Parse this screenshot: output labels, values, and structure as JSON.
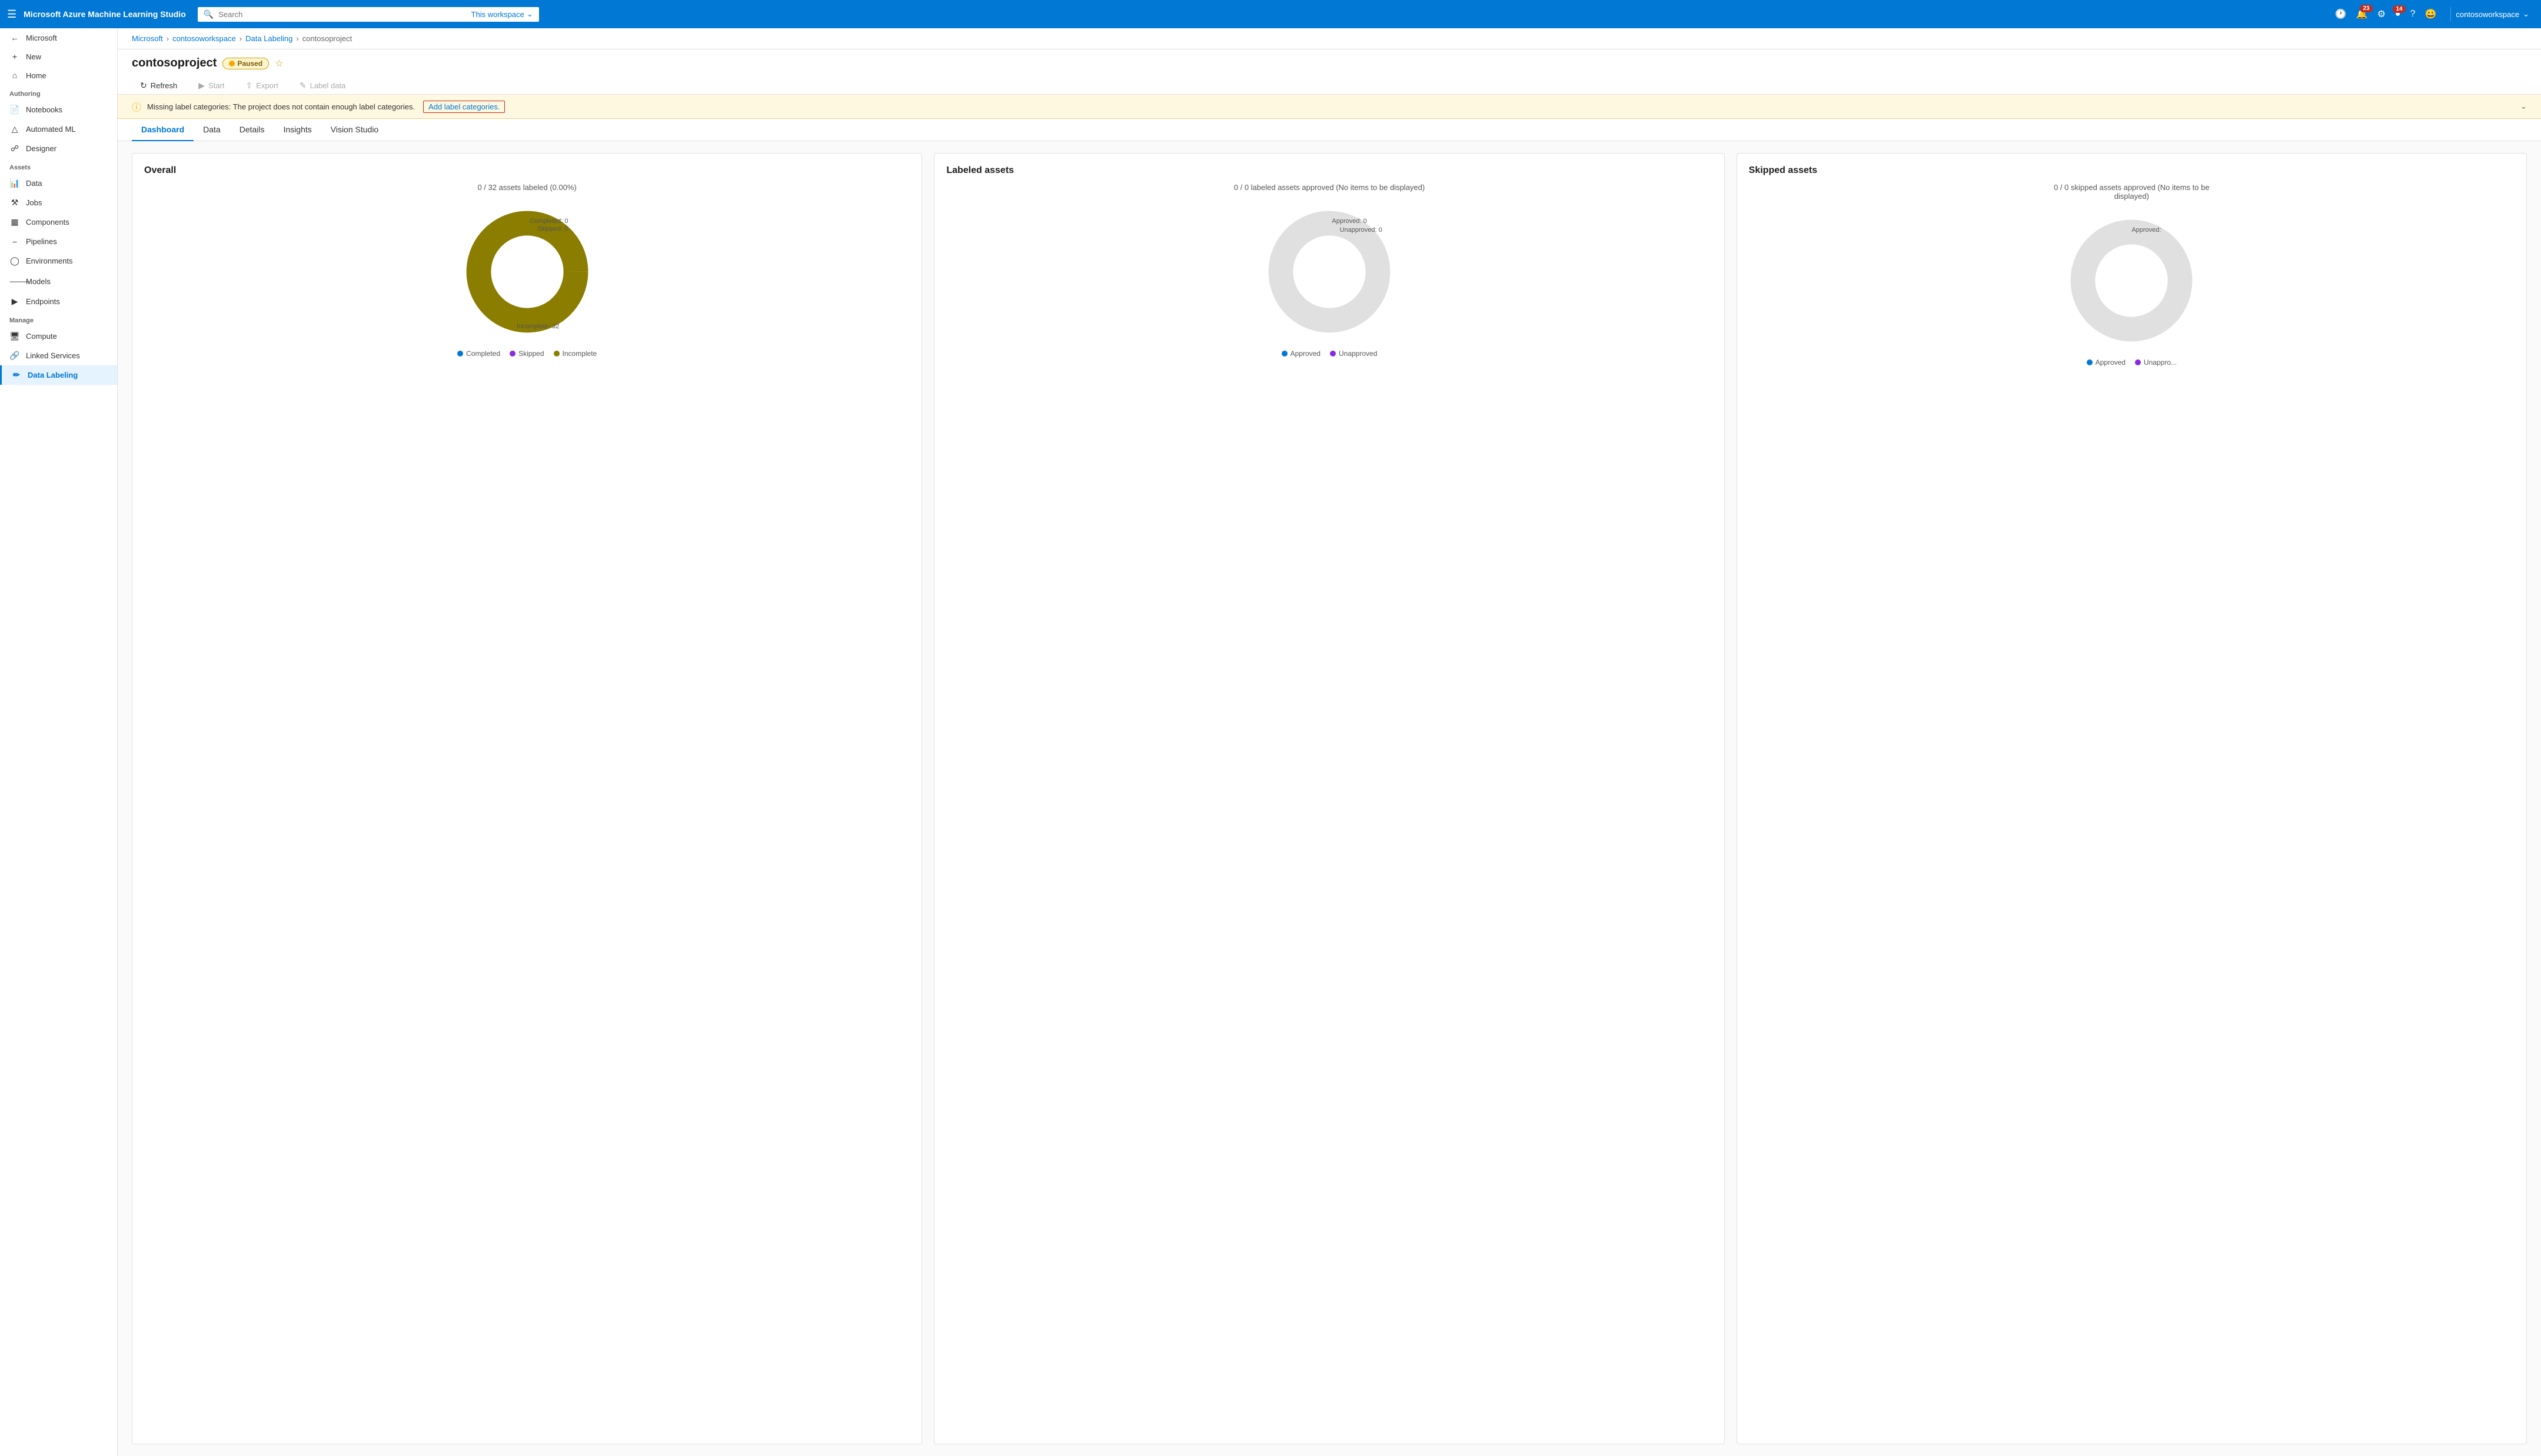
{
  "app": {
    "title": "Microsoft Azure Machine Learning Studio"
  },
  "topbar": {
    "search_placeholder": "Search",
    "search_scope": "This workspace",
    "notifications_count": "23",
    "settings_updates": "14",
    "workspace_name": "contosoworkspace"
  },
  "breadcrumb": {
    "items": [
      "Microsoft",
      "contosoworkspace",
      "Data Labeling",
      "contosoproject"
    ]
  },
  "project": {
    "name": "contosoproject",
    "status": "Paused"
  },
  "toolbar": {
    "refresh": "Refresh",
    "start": "Start",
    "export": "Export",
    "label_data": "Label data"
  },
  "warning": {
    "message": "Missing label categories: The project does not contain enough label categories.",
    "link_text": "Add label categories."
  },
  "tabs": {
    "items": [
      "Dashboard",
      "Data",
      "Details",
      "Insights",
      "Vision Studio"
    ],
    "active": "Dashboard"
  },
  "sidebar": {
    "microsoft_label": "Microsoft",
    "new_label": "New",
    "home_label": "Home",
    "authoring_label": "Authoring",
    "notebooks_label": "Notebooks",
    "automated_ml_label": "Automated ML",
    "designer_label": "Designer",
    "assets_label": "Assets",
    "data_label": "Data",
    "jobs_label": "Jobs",
    "components_label": "Components",
    "pipelines_label": "Pipelines",
    "environments_label": "Environments",
    "models_label": "Models",
    "endpoints_label": "Endpoints",
    "manage_label": "Manage",
    "compute_label": "Compute",
    "linked_services_label": "Linked Services",
    "data_labeling_label": "Data Labeling"
  },
  "overall_card": {
    "title": "Overall",
    "subtitle": "0 / 32 assets labeled (0.00%)",
    "completed_label": "Completed: 0",
    "skipped_label": "Skipped: 0",
    "incomplete_label": "Incomplete: 32",
    "legend": {
      "completed": "Completed",
      "skipped": "Skipped",
      "incomplete": "Incomplete"
    },
    "donut": {
      "incomplete_color": "#8B7D00",
      "completed_color": "#0078d4",
      "skipped_color": "#8a2be2"
    }
  },
  "labeled_assets_card": {
    "title": "Labeled assets",
    "subtitle": "0 / 0 labeled assets approved (No items to be displayed)",
    "approved_label": "Approved: 0",
    "unapproved_label": "Unapproved: 0",
    "legend": {
      "approved": "Approved",
      "unapproved": "Unapproved"
    }
  },
  "skipped_assets_card": {
    "title": "Skipped assets",
    "subtitle": "0 / 0 skipped assets approved (No items to be\ndisplayed)",
    "approved_label": "Approved:",
    "legend": {
      "approved": "Approved",
      "unapproved": "Unappro..."
    }
  }
}
